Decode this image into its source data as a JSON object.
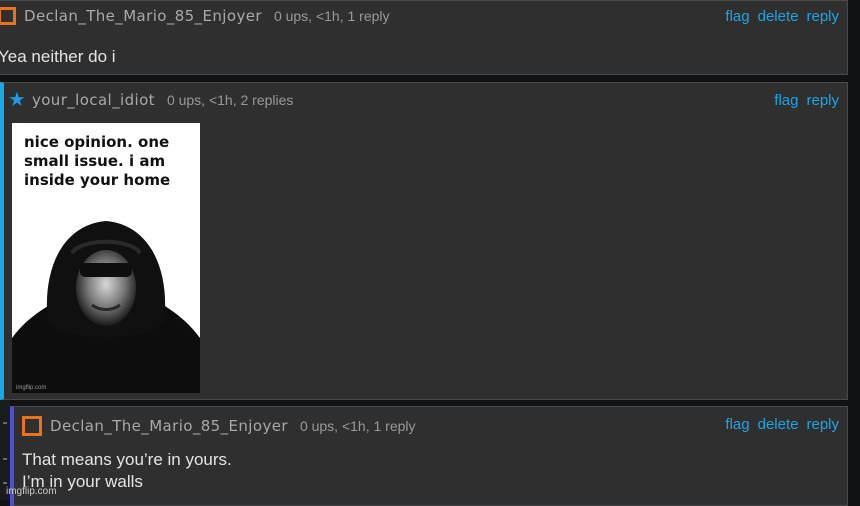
{
  "comments": [
    {
      "username": "Declan_The_Mario_85_Enjoyer",
      "meta": "0 ups, <1h, 1 reply",
      "actions": [
        "flag",
        "delete",
        "reply"
      ],
      "text": "Yea neither do i",
      "avatar_icon": "square-avatar-icon"
    },
    {
      "username": "your_local_idiot",
      "meta": "0 ups, <1h, 2 replies",
      "actions": [
        "flag",
        "reply"
      ],
      "avatar_icon": "star-avatar-icon",
      "meme": {
        "caption": "nice opinion. one small issue. i am inside your home",
        "watermark": "imgflip.com"
      }
    },
    {
      "username": "Declan_The_Mario_85_Enjoyer",
      "meta": "0 ups, <1h, 1 reply",
      "actions": [
        "flag",
        "delete",
        "reply"
      ],
      "text_lines": [
        "That means you’re in yours.",
        "I’m in your walls"
      ],
      "avatar_icon": "square-avatar-icon"
    }
  ],
  "watermark": "imgflip.com",
  "colors": {
    "background": "#111214",
    "panel": "#2f2f30",
    "link": "#1aa6e6",
    "accent_blue": "#18a9e6",
    "accent_indigo": "#4b50d6",
    "avatar_orange": "#e8731c",
    "star_blue": "#1d9ae2"
  }
}
